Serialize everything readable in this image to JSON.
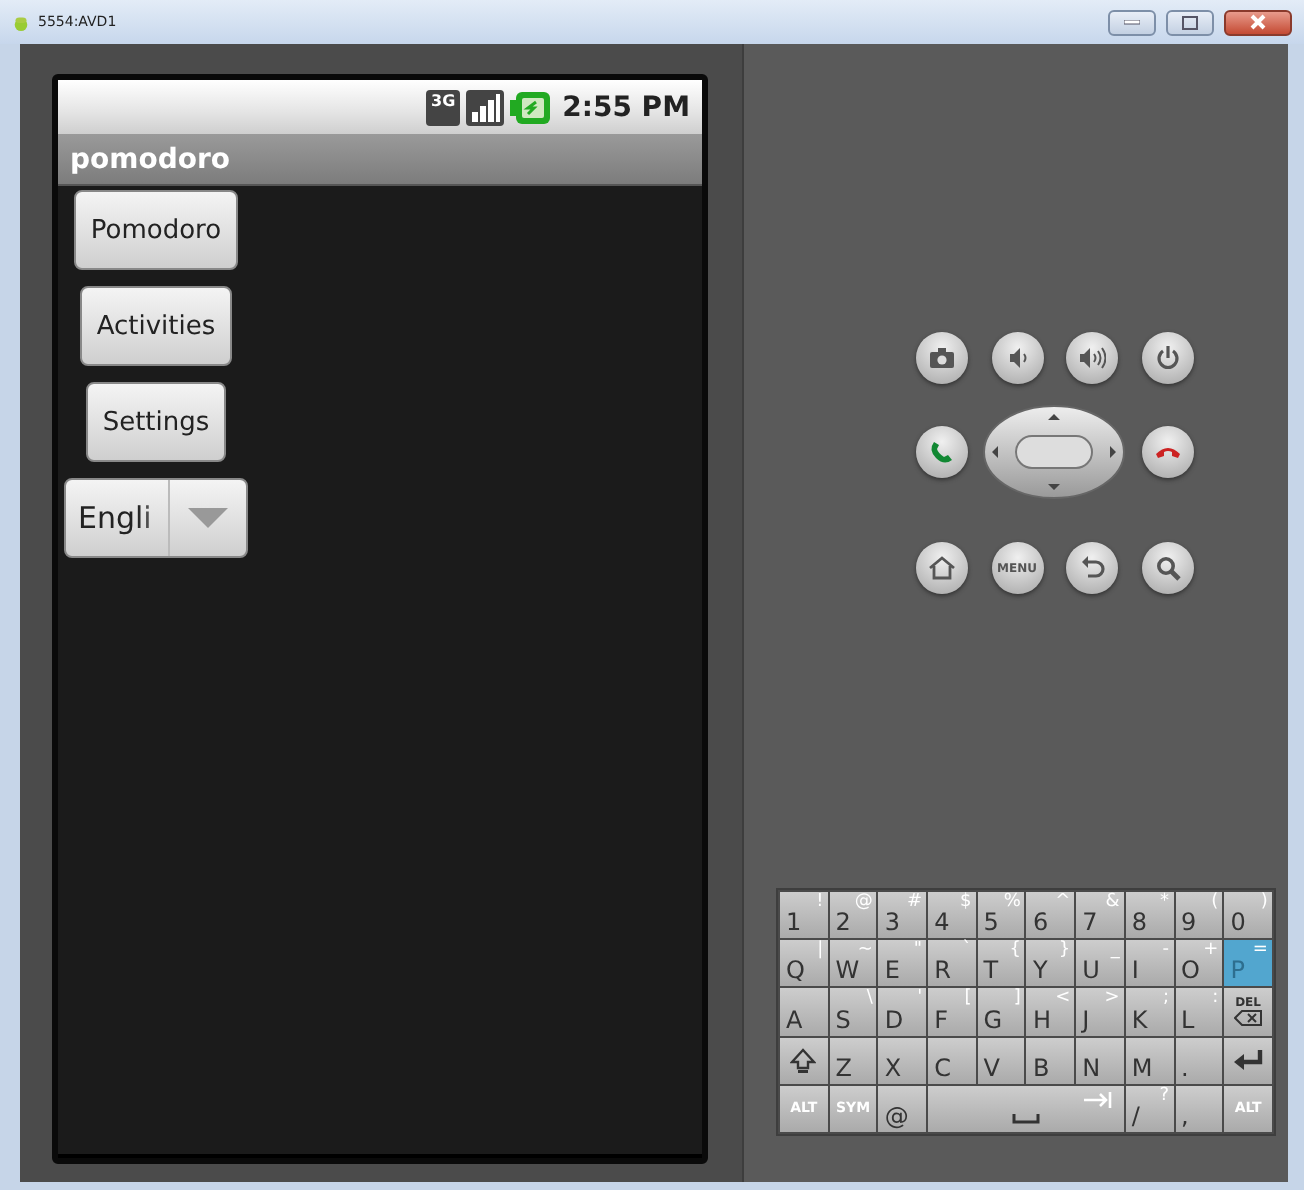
{
  "window": {
    "title": "5554:AVD1"
  },
  "phone": {
    "status_bar": {
      "network": "3G",
      "time": "2:55 PM"
    },
    "app_title": "pomodoro",
    "buttons": [
      {
        "label": "Pomodoro"
      },
      {
        "label": "Activities"
      },
      {
        "label": "Settings"
      }
    ],
    "spinner": {
      "value": "Engli"
    }
  },
  "controls": {
    "menu_label": "MENU"
  },
  "keyboard": {
    "rows": [
      {
        "keys": [
          {
            "kind": "char",
            "label": "1",
            "alt": "!",
            "selected": false
          },
          {
            "kind": "char",
            "label": "2",
            "alt": "@",
            "selected": false
          },
          {
            "kind": "char",
            "label": "3",
            "alt": "#",
            "selected": false
          },
          {
            "kind": "char",
            "label": "4",
            "alt": "$",
            "selected": false
          },
          {
            "kind": "char",
            "label": "5",
            "alt": "%",
            "selected": false
          },
          {
            "kind": "char",
            "label": "6",
            "alt": "^",
            "selected": false
          },
          {
            "kind": "char",
            "label": "7",
            "alt": "&",
            "selected": false
          },
          {
            "kind": "char",
            "label": "8",
            "alt": "*",
            "selected": false
          },
          {
            "kind": "char",
            "label": "9",
            "alt": "(",
            "selected": false
          },
          {
            "kind": "char",
            "label": "0",
            "alt": ")",
            "selected": false
          }
        ]
      },
      {
        "keys": [
          {
            "kind": "char",
            "label": "Q",
            "alt": "|",
            "selected": false
          },
          {
            "kind": "char",
            "label": "W",
            "alt": "~",
            "selected": false
          },
          {
            "kind": "char",
            "label": "E",
            "alt": "\"",
            "selected": false
          },
          {
            "kind": "char",
            "label": "R",
            "alt": "`",
            "selected": false
          },
          {
            "kind": "char",
            "label": "T",
            "alt": "{",
            "selected": false
          },
          {
            "kind": "char",
            "label": "Y",
            "alt": "}",
            "selected": false
          },
          {
            "kind": "char",
            "label": "U",
            "alt": "_",
            "selected": false
          },
          {
            "kind": "char",
            "label": "I",
            "alt": "-",
            "selected": false
          },
          {
            "kind": "char",
            "label": "O",
            "alt": "+",
            "selected": false
          },
          {
            "kind": "char",
            "label": "P",
            "alt": "=",
            "selected": true
          }
        ]
      },
      {
        "keys": [
          {
            "kind": "char",
            "label": "A",
            "selected": false
          },
          {
            "kind": "char",
            "label": "S",
            "alt": "\\",
            "selected": false
          },
          {
            "kind": "char",
            "label": "D",
            "alt": "'",
            "selected": false
          },
          {
            "kind": "char",
            "label": "F",
            "alt": "[",
            "selected": false
          },
          {
            "kind": "char",
            "label": "G",
            "alt": "]",
            "selected": false
          },
          {
            "kind": "char",
            "label": "H",
            "alt": "<",
            "selected": false
          },
          {
            "kind": "char",
            "label": "J",
            "alt": ">",
            "selected": false
          },
          {
            "kind": "char",
            "label": "K",
            "alt": ";",
            "selected": false
          },
          {
            "kind": "char",
            "label": "L",
            "alt": ":",
            "selected": false
          },
          {
            "kind": "del",
            "label": "DEL",
            "selected": false
          }
        ]
      },
      {
        "keys": [
          {
            "kind": "shift",
            "selected": false
          },
          {
            "kind": "char",
            "label": "Z",
            "selected": false
          },
          {
            "kind": "char",
            "label": "X",
            "selected": false
          },
          {
            "kind": "char",
            "label": "C",
            "selected": false
          },
          {
            "kind": "char",
            "label": "V",
            "selected": false
          },
          {
            "kind": "char",
            "label": "B",
            "selected": false
          },
          {
            "kind": "char",
            "label": "N",
            "selected": false
          },
          {
            "kind": "char",
            "label": "M",
            "selected": false
          },
          {
            "kind": "char",
            "label": ".",
            "selected": false
          },
          {
            "kind": "enter",
            "selected": false
          }
        ]
      },
      {
        "keys": [
          {
            "kind": "mod",
            "label": "ALT",
            "selected": false
          },
          {
            "kind": "mod",
            "label": "SYM",
            "selected": false
          },
          {
            "kind": "char",
            "label": "@",
            "selected": false
          },
          {
            "kind": "space",
            "selected": false
          },
          {
            "kind": "char",
            "label": "/",
            "alt": "?",
            "selected": false
          },
          {
            "kind": "char",
            "label": ",",
            "selected": false
          },
          {
            "kind": "mod",
            "label": "ALT",
            "selected": false
          }
        ]
      }
    ]
  }
}
